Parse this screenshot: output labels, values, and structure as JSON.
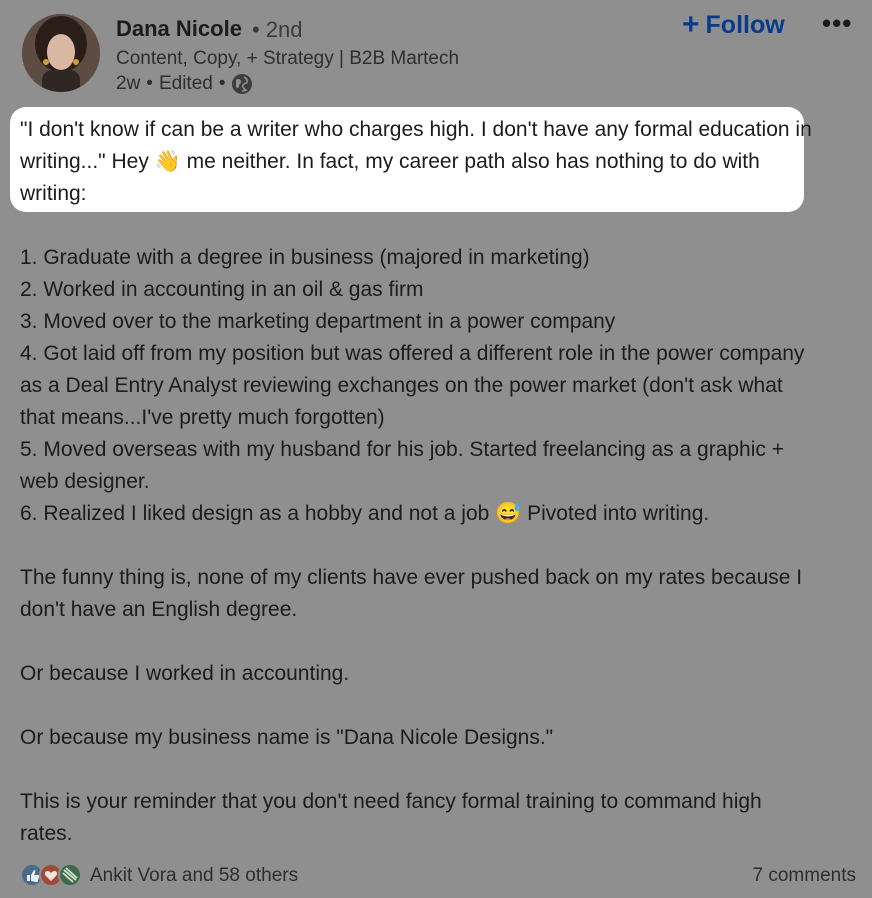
{
  "author": {
    "name": "Dana Nicole",
    "degree": "• 2nd",
    "headline": "Content, Copy, + Strategy | B2B Martech",
    "time": "2w",
    "edited": "Edited"
  },
  "actions": {
    "follow_label": "Follow",
    "more_label": "•••"
  },
  "post": {
    "paragraphs": [
      "\"I don't know if can be a writer who charges high. I don't have any formal education in writing...\" Hey 👋 me neither. In fact, my career path also has nothing to do with writing:",
      "1. Graduate with a degree in business (majored in marketing)",
      "2. Worked in accounting in an oil & gas firm",
      "3. Moved over to the marketing department in a power company",
      "4. Got laid off from my position but was offered a different role in the power company as a Deal Entry Analyst reviewing exchanges on the power market (don't ask what that means...I've pretty much forgotten)",
      "5. Moved overseas with my husband for his job. Started freelancing as a graphic + web designer.",
      "6. Realized I liked design as a hobby and not a job 😅 Pivoted into writing.",
      "The funny thing is, none of my clients have ever pushed back on my rates because I don't have an English degree.",
      "Or because I worked in accounting.",
      "Or because my business name is \"Dana Nicole Designs.\"",
      "This is your reminder that you don't need fancy formal training to command high rates."
    ]
  },
  "social": {
    "reactions": "Ankit Vora and 58 others",
    "comments": "7 comments"
  },
  "colors": {
    "accent": "#0a3a8c",
    "overlay": "#8f8f8f",
    "highlight": "#ffffff"
  },
  "icons": [
    "globe-icon",
    "like-reaction-icon",
    "love-reaction-icon",
    "insightful-reaction-icon",
    "plus-icon",
    "more-icon"
  ]
}
